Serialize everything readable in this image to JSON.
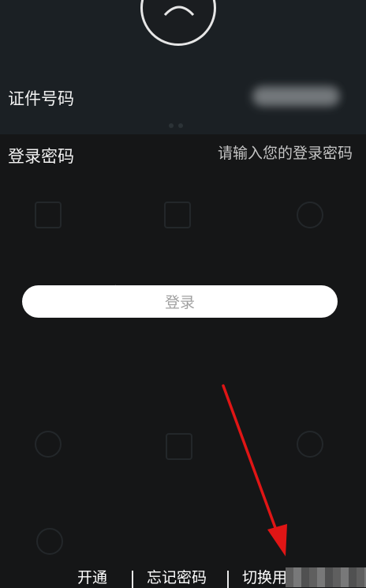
{
  "form": {
    "id_label": "证件号码",
    "password_label": "登录密码",
    "password_placeholder": "请输入您的登录密码",
    "login_button": "登录"
  },
  "footer": {
    "open_link": "开通",
    "forgot_link": "忘记密码",
    "switch_user_link": "切换用"
  },
  "colors": {
    "background": "#151617",
    "button_bg": "#ffffff",
    "annotation_arrow": "#e01515"
  }
}
